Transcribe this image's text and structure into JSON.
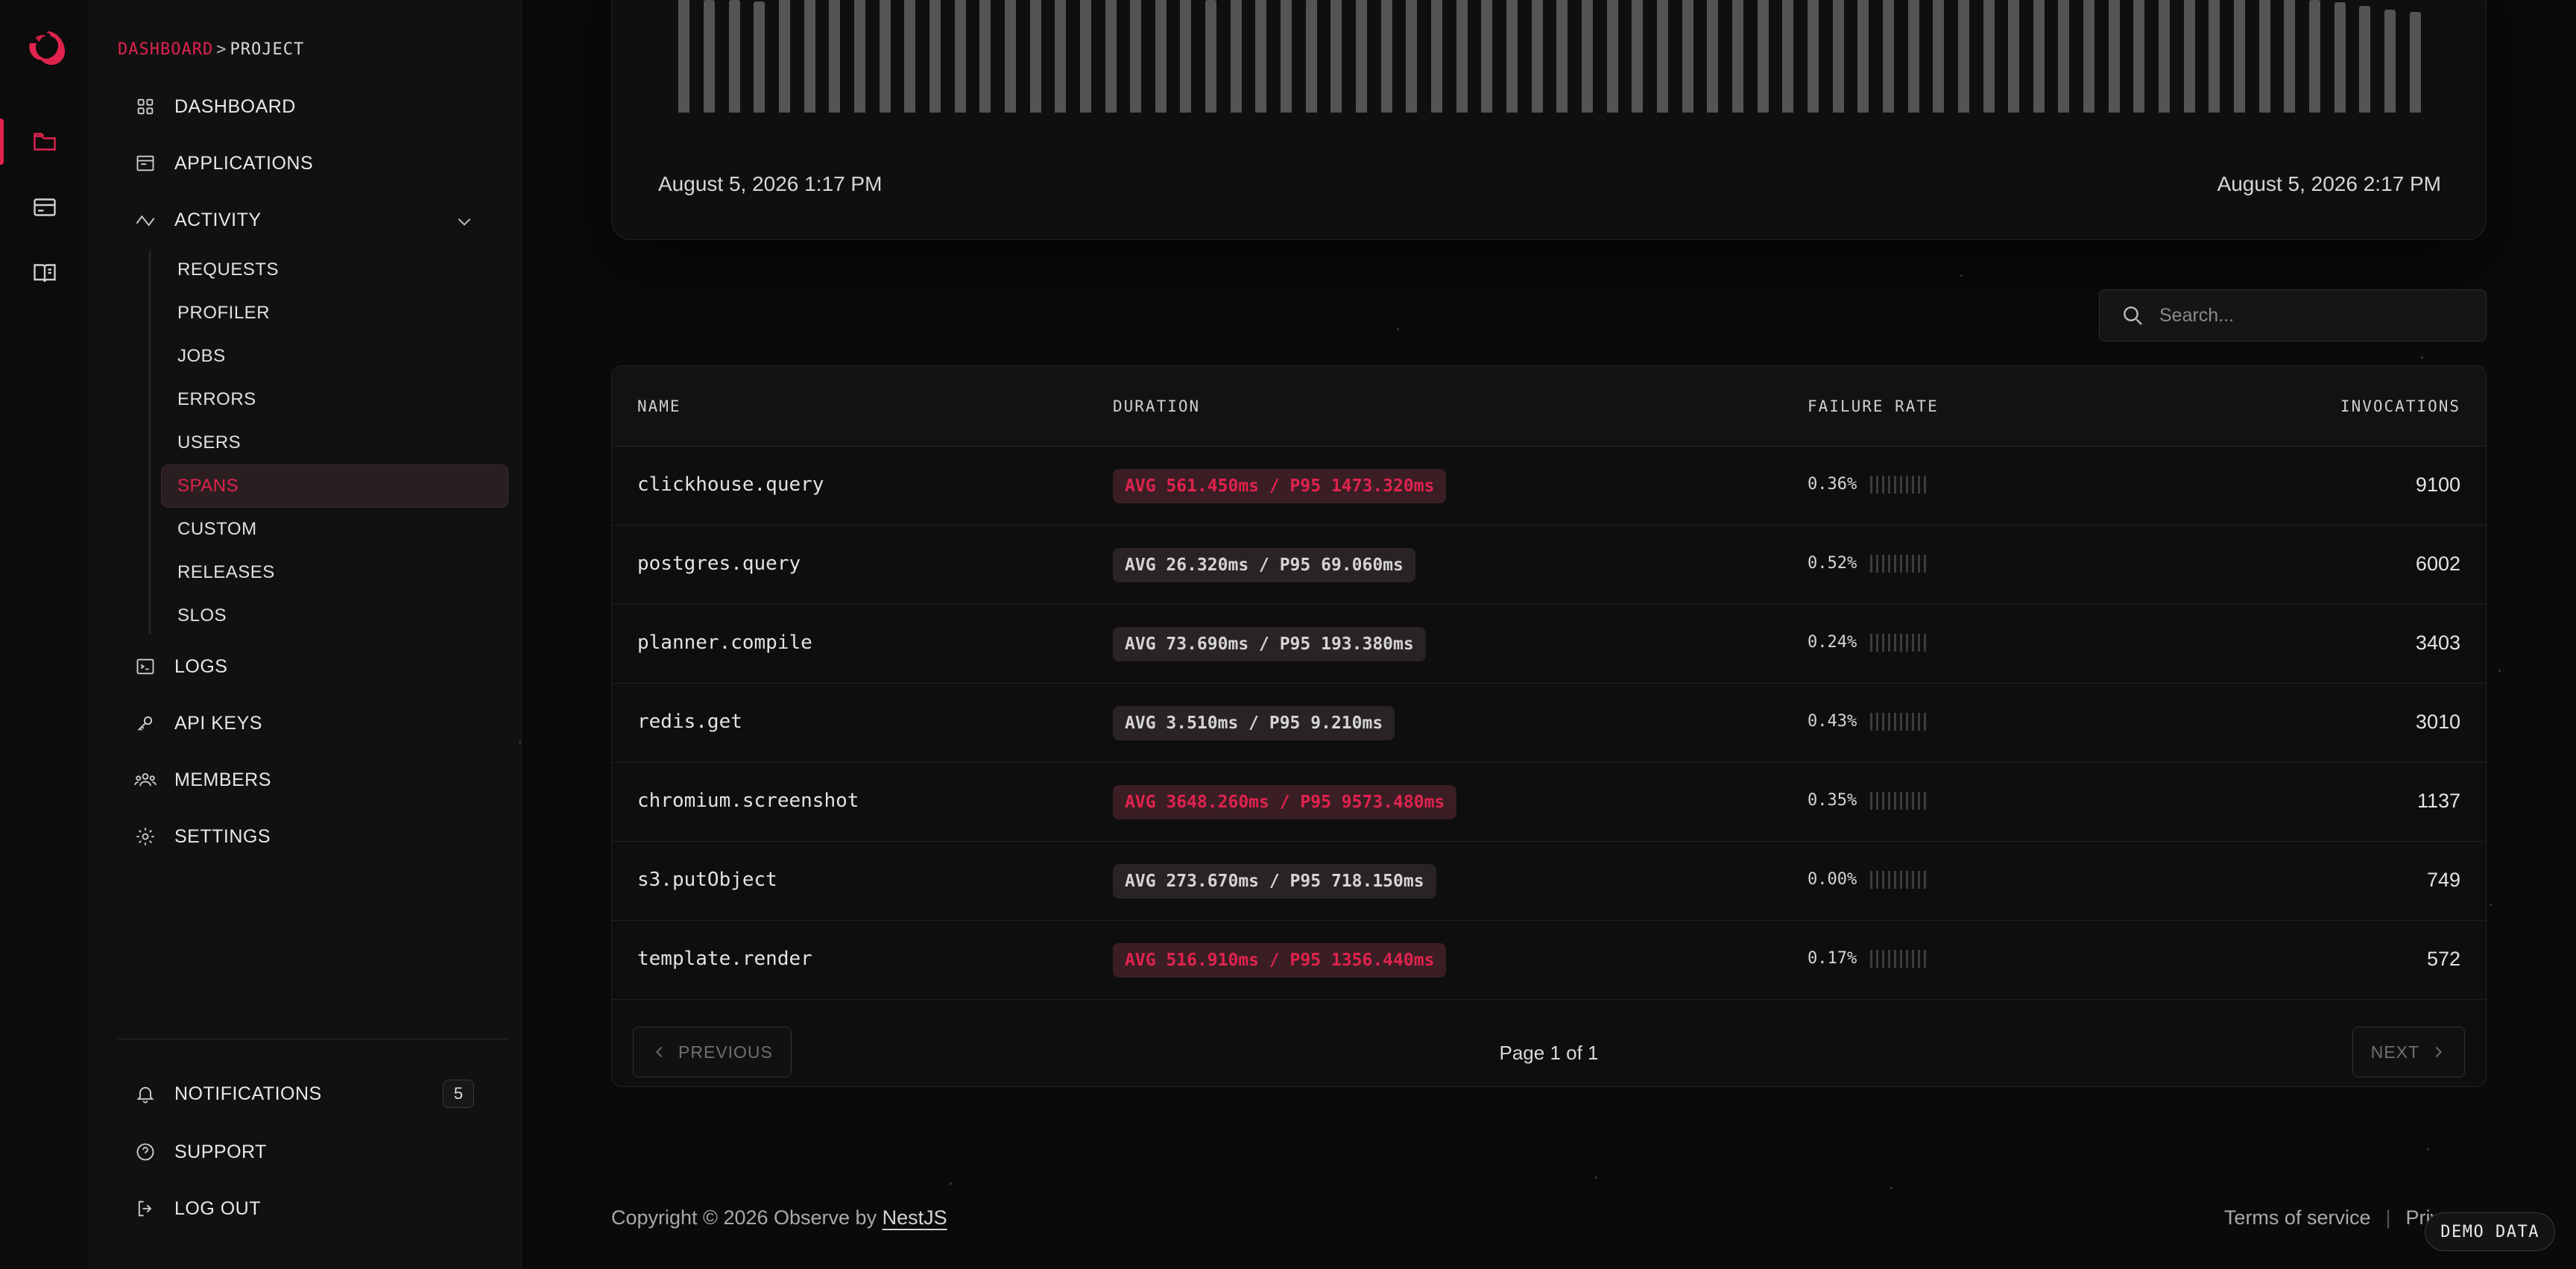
{
  "breadcrumb": {
    "root": "DASHBOARD",
    "separator": ">",
    "current": "PROJECT"
  },
  "nav": {
    "dashboard": "DASHBOARD",
    "applications": "APPLICATIONS",
    "activity": "ACTIVITY",
    "activity_items": [
      "REQUESTS",
      "PROFILER",
      "JOBS",
      "ERRORS",
      "USERS",
      "SPANS",
      "CUSTOM",
      "RELEASES",
      "SLOS"
    ],
    "logs": "LOGS",
    "api_keys": "API KEYS",
    "members": "MEMBERS",
    "settings": "SETTINGS",
    "notifications": "NOTIFICATIONS",
    "notifications_count": "5",
    "support": "SUPPORT",
    "logout": "LOG OUT"
  },
  "chart_data": {
    "type": "bar",
    "x_start_label": "August 5, 2026 1:17 PM",
    "x_end_label": "August 5, 2026 2:17 PM",
    "values": [
      100,
      98,
      98,
      97,
      100,
      104,
      102,
      101,
      103,
      101,
      104,
      101,
      103,
      102,
      103,
      104,
      102,
      101,
      100,
      103,
      100,
      98,
      100,
      104,
      102,
      99,
      101,
      102,
      103,
      101,
      103,
      104,
      101,
      102,
      103,
      103,
      101,
      102,
      104,
      102,
      103,
      101,
      102,
      104,
      103,
      104,
      102,
      103,
      101,
      102,
      103,
      104,
      102,
      103,
      101,
      102,
      103,
      101,
      104,
      102,
      102,
      101,
      103,
      104,
      102,
      98,
      96,
      93,
      90,
      88
    ],
    "color": "#555353"
  },
  "search": {
    "placeholder": "Search..."
  },
  "table": {
    "columns": [
      "NAME",
      "DURATION",
      "FAILURE RATE",
      "INVOCATIONS"
    ],
    "rows": [
      {
        "name": "clickhouse.query",
        "duration": "AVG 561.450ms / P95 1473.320ms",
        "hot": true,
        "failure": "0.36%",
        "invocations": "9100"
      },
      {
        "name": "postgres.query",
        "duration": "AVG 26.320ms / P95 69.060ms",
        "hot": false,
        "failure": "0.52%",
        "invocations": "6002"
      },
      {
        "name": "planner.compile",
        "duration": "AVG 73.690ms / P95 193.380ms",
        "hot": false,
        "failure": "0.24%",
        "invocations": "3403"
      },
      {
        "name": "redis.get",
        "duration": "AVG 3.510ms / P95 9.210ms",
        "hot": false,
        "failure": "0.43%",
        "invocations": "3010"
      },
      {
        "name": "chromium.screenshot",
        "duration": "AVG 3648.260ms / P95 9573.480ms",
        "hot": true,
        "failure": "0.35%",
        "invocations": "1137"
      },
      {
        "name": "s3.putObject",
        "duration": "AVG 273.670ms / P95 718.150ms",
        "hot": false,
        "failure": "0.00%",
        "invocations": "749"
      },
      {
        "name": "template.render",
        "duration": "AVG 516.910ms / P95 1356.440ms",
        "hot": true,
        "failure": "0.17%",
        "invocations": "572"
      }
    ]
  },
  "pagination": {
    "previous": "PREVIOUS",
    "next": "NEXT",
    "label": "Page 1 of 1"
  },
  "footer": {
    "copyright": "Copyright © 2026 Observe by",
    "brand_link": "NestJS",
    "terms": "Terms of service",
    "privacy": "Privacy",
    "separator": "|"
  },
  "demo_badge": "DEMO DATA",
  "colors": {
    "accent": "#e0234e",
    "background": "#0a0a0a",
    "sidebar": "#111111"
  }
}
